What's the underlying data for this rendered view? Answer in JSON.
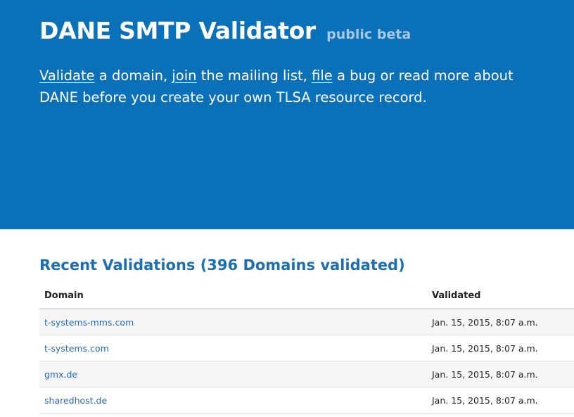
{
  "header": {
    "title": "DANE SMTP Validator",
    "badge": "public beta"
  },
  "intro": {
    "validate_link": "Validate",
    "text1": " a domain, ",
    "join_link": "join",
    "text2": " the mailing list, ",
    "file_link": "file",
    "text3": " a bug or read more about DANE before you create your own TLSA resource record."
  },
  "recent": {
    "title": "Recent Validations (396 Domains validated)",
    "columns": [
      "Domain",
      "Validated"
    ],
    "rows": [
      {
        "domain": "t-systems-mms.com",
        "validated": "Jan. 15, 2015, 8:07 a.m."
      },
      {
        "domain": "t-systems.com",
        "validated": "Jan. 15, 2015, 8:07 a.m."
      },
      {
        "domain": "gmx.de",
        "validated": "Jan. 15, 2015, 8:07 a.m."
      },
      {
        "domain": "sharedhost.de",
        "validated": "Jan. 15, 2015, 8:07 a.m."
      }
    ]
  },
  "colors": {
    "hero_bg": "#0a70b8",
    "accent": "#1d6fb0",
    "link": "#2a6ab0"
  }
}
